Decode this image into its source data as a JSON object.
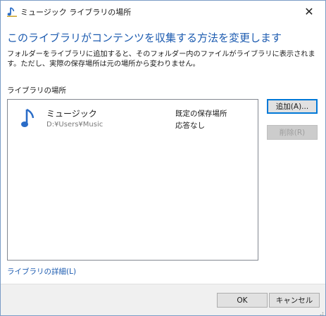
{
  "window": {
    "title": "ミュージック ライブラリの場所",
    "close_glyph": "✕"
  },
  "heading": "このライブラリがコンテンツを収集する方法を変更します",
  "description": "フォルダーをライブラリに追加すると、そのフォルダー内のファイルがライブラリに表示されます。ただし、実際の保存場所は元の場所から変わりません。",
  "section_label": "ライブラリの場所",
  "locations": [
    {
      "name": "ミュージック",
      "path": "D:¥Users¥Music",
      "status_line1": "既定の保存場所",
      "status_line2": "応答なし",
      "icon": "music-note-icon"
    }
  ],
  "buttons": {
    "add": "追加(A)...",
    "remove": "削除(R)",
    "ok": "OK",
    "cancel": "キャンセル"
  },
  "details_link": "ライブラリの詳細(L)",
  "colors": {
    "accent": "#1c5bb0",
    "note_blue": "#2a6cc7"
  }
}
